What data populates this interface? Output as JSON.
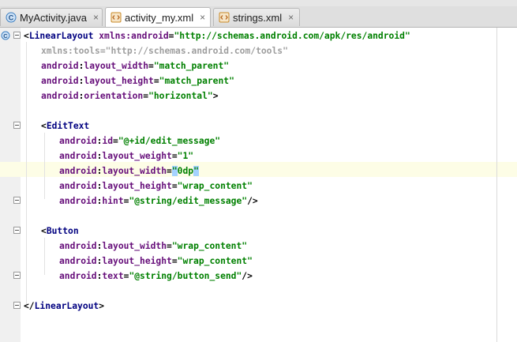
{
  "tabs": [
    {
      "label": "MyActivity.java",
      "icon": "java-class-icon"
    },
    {
      "label": "activity_my.xml",
      "icon": "xml-file-icon"
    },
    {
      "label": "strings.xml",
      "icon": "xml-file-icon"
    }
  ],
  "close_glyph": "×",
  "code": {
    "l1": {
      "tag": "LinearLayout",
      "attr": "xmlns:android",
      "val": "\"http://schemas.android.com/apk/res/android\""
    },
    "l2": {
      "attr": "xmlns:tools",
      "val": "\"http://schemas.android.com/tools\""
    },
    "l3": {
      "ns": "android",
      "attr": "layout_width",
      "val": "\"match_parent\""
    },
    "l4": {
      "ns": "android",
      "attr": "layout_height",
      "val": "\"match_parent\""
    },
    "l5": {
      "ns": "android",
      "attr": "orientation",
      "val": "\"horizontal\"",
      "end": ">"
    },
    "l7": {
      "tag": "EditText"
    },
    "l8": {
      "ns": "android",
      "attr": "id",
      "val": "\"@+id/edit_message\""
    },
    "l9": {
      "ns": "android",
      "attr": "layout_weight",
      "val": "\"1\""
    },
    "l10": {
      "ns": "android",
      "attr": "layout_width",
      "val_open": "\"",
      "val_mid": "0dp",
      "val_close": "\""
    },
    "l11": {
      "ns": "android",
      "attr": "layout_height",
      "val": "\"wrap_content\""
    },
    "l12": {
      "ns": "android",
      "attr": "hint",
      "val": "\"@string/edit_message\"",
      "end": "/>"
    },
    "l14": {
      "tag": "Button"
    },
    "l15": {
      "ns": "android",
      "attr": "layout_width",
      "val": "\"wrap_content\""
    },
    "l16": {
      "ns": "android",
      "attr": "layout_height",
      "val": "\"wrap_content\""
    },
    "l17": {
      "ns": "android",
      "attr": "text",
      "val": "\"@string/button_send\"",
      "end": "/>"
    },
    "l19": {
      "tag": "LinearLayout"
    }
  },
  "colors": {
    "tag": "#000080",
    "attribute": "#660e7a",
    "value": "#008000",
    "caret_line": "#fdfde6",
    "selection": "#a5d2ff"
  }
}
